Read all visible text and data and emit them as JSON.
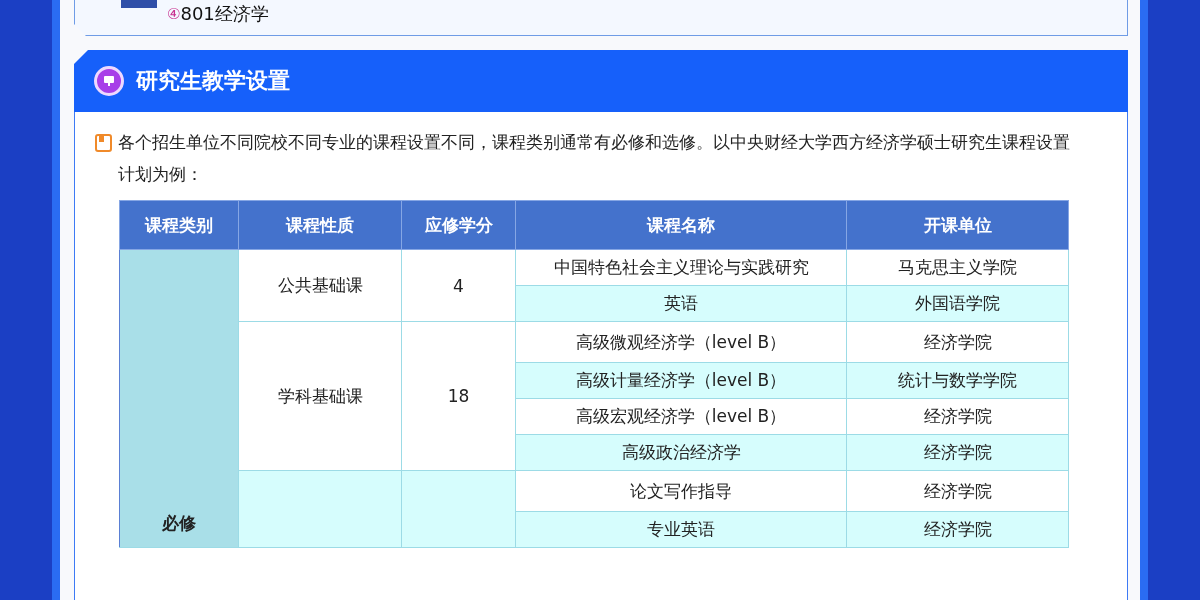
{
  "top_card": {
    "marker": "④",
    "text": "801经济学"
  },
  "section": {
    "title": "研究生教学设置",
    "intro": "各个招生单位不同院校不同专业的课程设置不同，课程类别通常有必修和选修。以中央财经大学西方经济学硕士研究生课程设置计划为例：",
    "table": {
      "columns": [
        "课程类别",
        "课程性质",
        "应修学分",
        "课程名称",
        "开课单位"
      ],
      "groups": [
        {
          "category": "必修",
          "subgroups": [
            {
              "nature": "公共基础课",
              "credits": "4",
              "courses": [
                {
                  "name": "中国特色社会主义理论与实践研究",
                  "unit": "马克思主义学院"
                },
                {
                  "name": "英语",
                  "unit": "外国语学院"
                }
              ]
            },
            {
              "nature": "学科基础课",
              "credits": "18",
              "courses": [
                {
                  "name": "高级微观经济学（level B）",
                  "unit": "经济学院"
                },
                {
                  "name": "高级计量经济学（level B）",
                  "unit": "统计与数学学院"
                },
                {
                  "name": "高级宏观经济学（level B）",
                  "unit": "经济学院"
                },
                {
                  "name": "高级政治经济学",
                  "unit": "经济学院"
                }
              ]
            },
            {
              "courses": [
                {
                  "name": "论文写作指导",
                  "unit": "经济学院"
                },
                {
                  "name": "专业英语",
                  "unit": "经济学院"
                }
              ]
            }
          ]
        }
      ]
    }
  }
}
